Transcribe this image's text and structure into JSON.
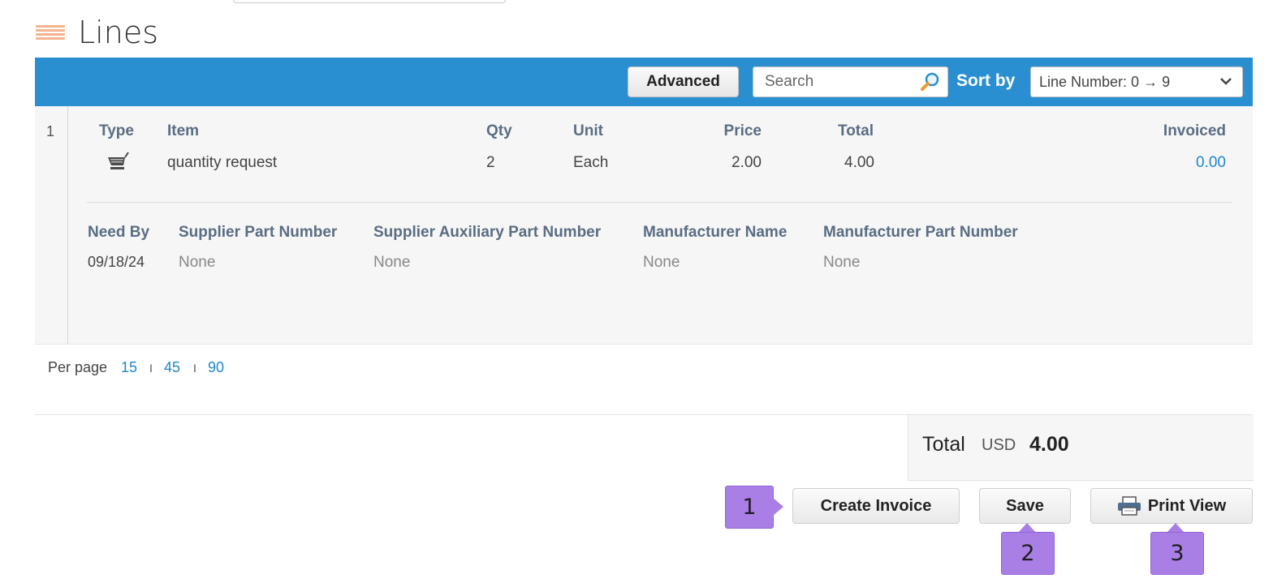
{
  "section": {
    "title": "Lines"
  },
  "toolbar": {
    "advanced_label": "Advanced",
    "search_placeholder": "Search",
    "sort_by_label": "Sort by",
    "sort_value": "Line Number: 0 → 9"
  },
  "line": {
    "number": "1",
    "headers": {
      "type": "Type",
      "item": "Item",
      "qty": "Qty",
      "unit": "Unit",
      "price": "Price",
      "total": "Total",
      "invoiced": "Invoiced"
    },
    "values": {
      "type_icon": "shopping-cart-icon",
      "item": "quantity request",
      "qty": "2",
      "unit": "Each",
      "price": "2.00",
      "total": "4.00",
      "invoiced": "0.00"
    },
    "details": {
      "headers": {
        "need_by": "Need By",
        "supplier_part_number": "Supplier Part Number",
        "supplier_aux_part_number": "Supplier Auxiliary Part Number",
        "manufacturer_name": "Manufacturer Name",
        "manufacturer_part_number": "Manufacturer Part Number"
      },
      "values": {
        "need_by": "09/18/24",
        "supplier_part_number": "None",
        "supplier_aux_part_number": "None",
        "manufacturer_name": "None",
        "manufacturer_part_number": "None"
      }
    }
  },
  "pagination": {
    "per_page_label": "Per page",
    "options": [
      "15",
      "45",
      "90"
    ],
    "separator": "I"
  },
  "totals": {
    "label": "Total",
    "currency": "USD",
    "amount": "4.00"
  },
  "actions": {
    "create_invoice": "Create Invoice",
    "save": "Save",
    "print_view": "Print View"
  },
  "callouts": [
    "1",
    "2",
    "3"
  ],
  "colors": {
    "toolbar": "#2a8fd0",
    "link": "#1f87c8",
    "callout": "#a97fe6"
  }
}
